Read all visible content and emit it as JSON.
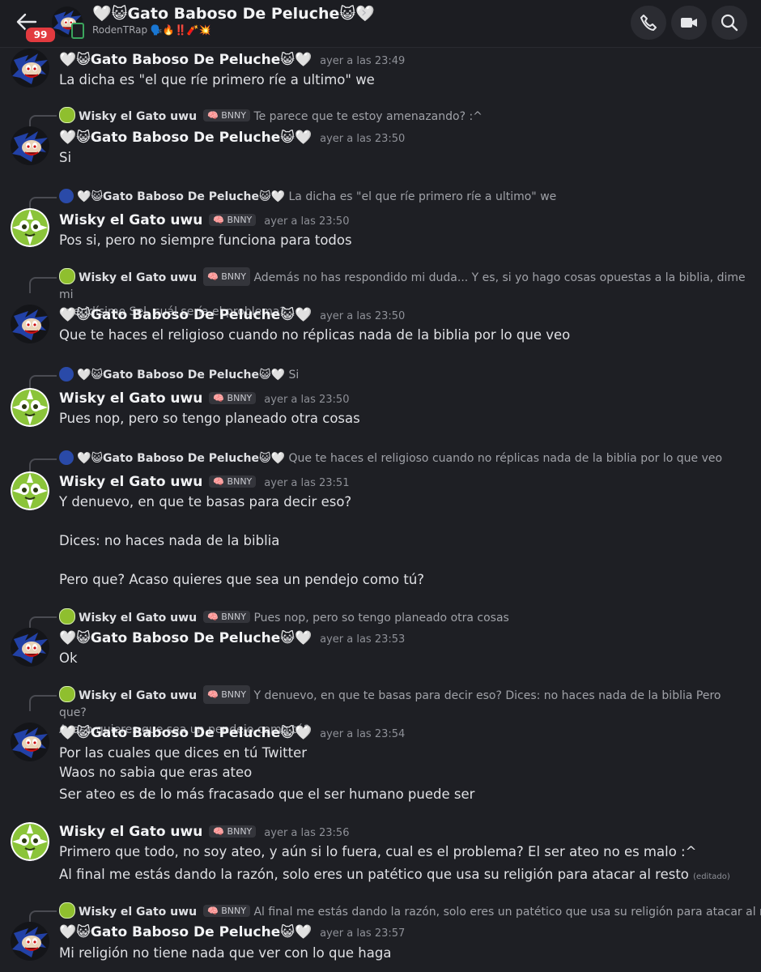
{
  "header": {
    "badge": "99",
    "title": "🤍😺Gato Baboso De Peluche😺🤍",
    "subtitle": "RodenTRap 🗣️🔥‼️🧨💥"
  },
  "names": {
    "gato": "🤍😺Gato Baboso De Peluche😺🤍",
    "wisky": "Wisky el Gato uwu",
    "wisky_tag": "BNNY"
  },
  "messages": [
    {
      "ts": "ayer a las 23:49",
      "lines": [
        "La dicha es \"el que ríe primero ríe a ultimo\" we"
      ]
    },
    {
      "reply": "Te parece que te estoy amenazando? :^",
      "ts": "ayer a las 23:50",
      "lines": [
        "Si"
      ]
    },
    {
      "reply": "La dicha es \"el que ríe primero ríe a ultimo\" we",
      "ts": "ayer a las 23:50",
      "lines": [
        "Pos si, pero no siempre funciona para todos"
      ]
    },
    {
      "reply": "Además no has respondido mi duda...   Y es, si yo hago cosas opuestas a la biblia, dime mi",
      "reply2": "queridísimo Sel, cuál sería el problema?",
      "ts": "ayer a las 23:50",
      "lines": [
        "Que te haces el religioso cuando no réplicas nada de la biblia por lo que veo"
      ]
    },
    {
      "reply": "Si",
      "ts": "ayer a las 23:50",
      "lines": [
        "Pues nop, pero so tengo planeado otra cosas"
      ]
    },
    {
      "reply": "Que te haces el religioso cuando no réplicas nada de la biblia por lo que veo",
      "ts": "ayer a las 23:51",
      "lines": [
        "Y denuevo, en que te basas para decir eso?",
        "Dices: no haces nada de la biblia",
        "Pero que? Acaso quieres que sea un pendejo como tú?"
      ]
    },
    {
      "reply": "Pues nop, pero so tengo planeado otra cosas",
      "ts": "ayer a las 23:53",
      "lines": [
        "Ok"
      ]
    },
    {
      "reply": "Y denuevo, en que te basas para decir eso?   Dices: no haces nada de la biblia  Pero que?",
      "reply2": "Acaso quieres que sea un pendejo como tú?",
      "ts": "ayer a las 23:54",
      "lines": [
        "Por las cuales que dices en tú Twitter",
        "Waos no sabia que eras ateo",
        "Ser ateo es de lo más fracasado que el ser humano puede ser"
      ]
    },
    {
      "ts": "ayer a las 23:56",
      "lines": [
        "Primero que todo, no soy ateo, y aún si lo fuera, cual es el problema? El ser ateo no es malo :^",
        "Al final me estás dando la razón, solo eres un patético que usa su religión para atacar al resto"
      ],
      "edited": "(editado)"
    },
    {
      "reply": "Al final me estás dando la razón, solo eres un patético que usa su religión para atacar al resto",
      "ts": "ayer a las 23:57",
      "lines": [
        "Mi religión no tiene nada que ver con lo que haga"
      ]
    }
  ],
  "colors": {
    "background": "#1e1f24",
    "badge": "#e23a3f",
    "tag_pink": "#ff7aa8"
  },
  "icons": [
    "back-arrow-icon",
    "phone-icon",
    "video-icon",
    "search-icon"
  ]
}
